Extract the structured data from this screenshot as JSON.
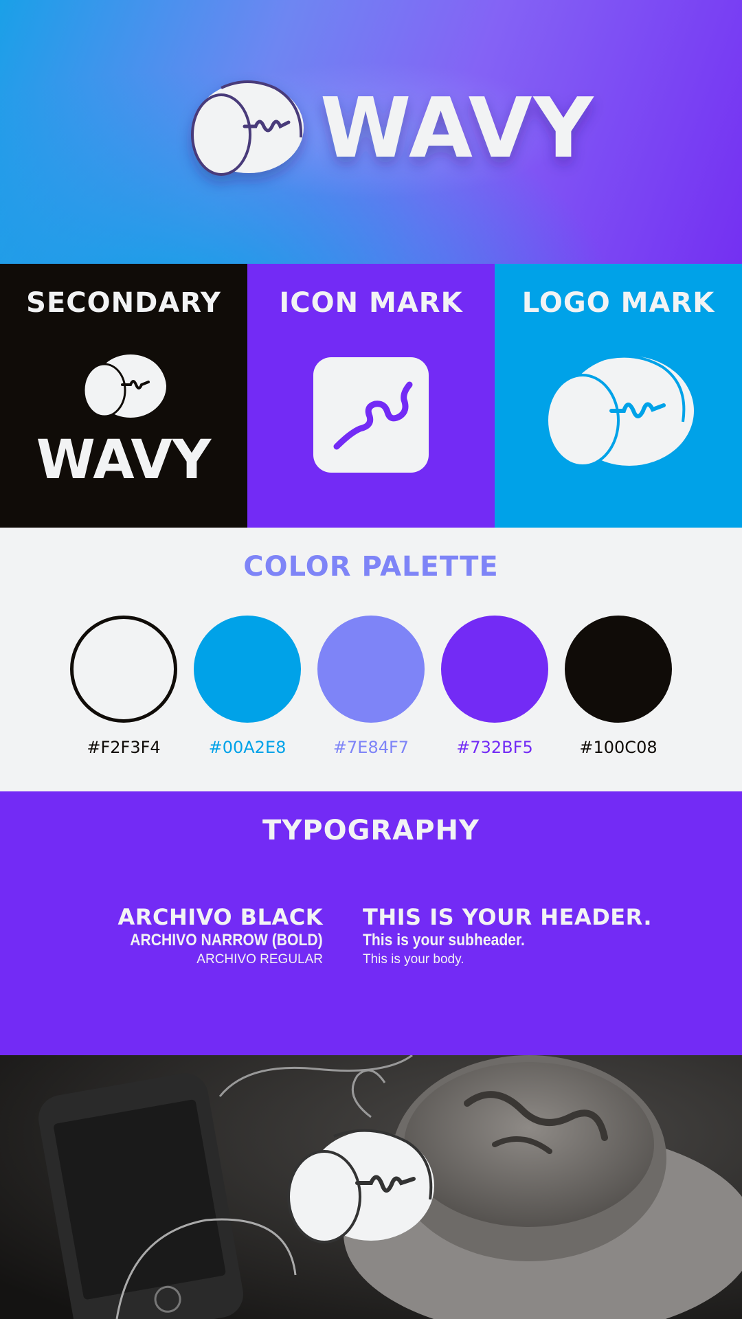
{
  "hero": {
    "brand_name": "WAVY",
    "logo_icon": "headphone-head-icon"
  },
  "panels": [
    {
      "title": "SECONDARY",
      "background": "#100C08",
      "content": "WAVY",
      "icon": "headphone-head-icon"
    },
    {
      "title": "ICON MARK",
      "background": "#732BF5",
      "icon": "wave-squiggle-icon"
    },
    {
      "title": "LOGO MARK",
      "background": "#00A2E8",
      "icon": "headphone-head-icon"
    }
  ],
  "palette": {
    "title": "COLOR PALETTE",
    "swatches": [
      {
        "hex": "#F2F3F4",
        "label_color": "#100C08"
      },
      {
        "hex": "#00A2E8",
        "label_color": "#00A2E8"
      },
      {
        "hex": "#7E84F7",
        "label_color": "#7E84F7"
      },
      {
        "hex": "#732BF5",
        "label_color": "#732BF5"
      },
      {
        "hex": "#100C08",
        "label_color": "#100C08"
      }
    ]
  },
  "typography": {
    "title": "TYPOGRAPHY",
    "font_names": [
      "ARCHIVO BLACK",
      "ARCHIVO NARROW (BOLD)",
      "ARCHIVO REGULAR"
    ],
    "samples": [
      "THIS IS YOUR HEADER.",
      "This is your subheader.",
      "This is your body."
    ]
  },
  "photo": {
    "description_icon": "headphone-head-icon"
  }
}
